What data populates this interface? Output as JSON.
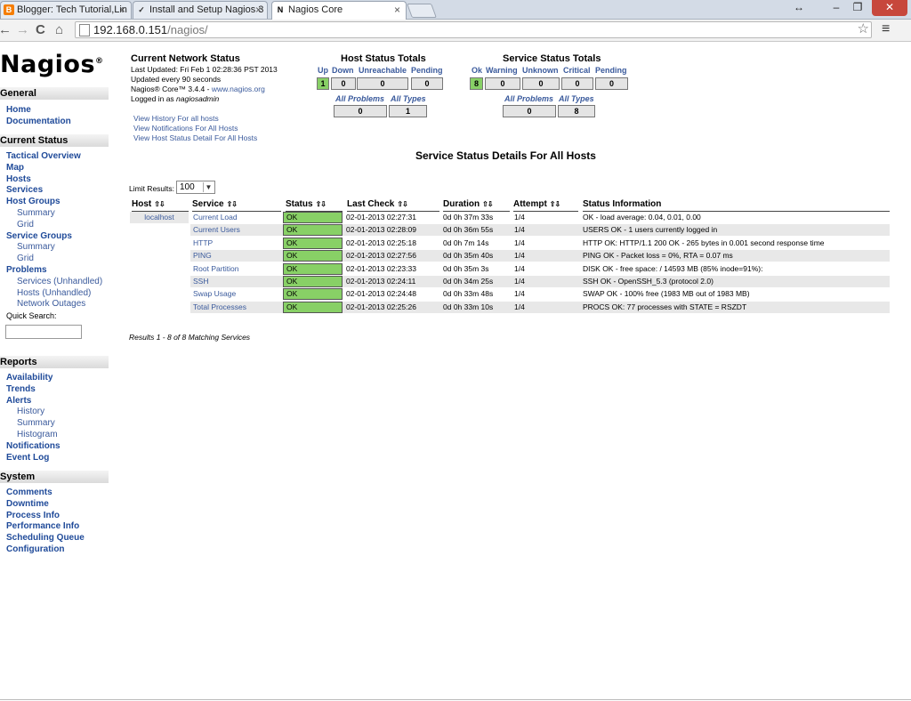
{
  "browser": {
    "tabs": [
      {
        "title": "Blogger: Tech Tutorial,Lin",
        "icon": "blogger-icon",
        "active": false
      },
      {
        "title": "Install and Setup Nagios 3",
        "icon": "checkmark-icon",
        "active": false
      },
      {
        "title": "Nagios Core",
        "icon": "nagios-n-icon",
        "active": true
      }
    ],
    "close_glyph": "×",
    "url_host": "192.168.0.151",
    "url_path": "/nagios/",
    "back": "←",
    "forward": "→",
    "reload": "C",
    "home": "⌂",
    "star": "☆",
    "menu": "≡",
    "win_resize": "↔",
    "win_min": "–",
    "win_max": "❐",
    "win_close": "✕"
  },
  "logo": {
    "text": "Nagios",
    "mark": "®"
  },
  "sidebar": {
    "sections": [
      {
        "title": "General",
        "items": [
          {
            "label": "Home",
            "sub": false
          },
          {
            "label": "Documentation",
            "sub": false
          }
        ]
      },
      {
        "title": "Current Status",
        "items": [
          {
            "label": "Tactical Overview",
            "sub": false
          },
          {
            "label": "Map",
            "sub": false
          },
          {
            "label": "Hosts",
            "sub": false
          },
          {
            "label": "Services",
            "sub": false
          },
          {
            "label": "Host Groups",
            "sub": false
          },
          {
            "label": "Summary",
            "sub": true
          },
          {
            "label": "Grid",
            "sub": true
          },
          {
            "label": "Service Groups",
            "sub": false
          },
          {
            "label": "Summary",
            "sub": true
          },
          {
            "label": "Grid",
            "sub": true
          },
          {
            "label": "Problems",
            "sub": false
          },
          {
            "label": "Services (Unhandled)",
            "sub": true
          },
          {
            "label": "Hosts (Unhandled)",
            "sub": true
          },
          {
            "label": "Network Outages",
            "sub": true
          }
        ]
      },
      {
        "title": "Reports",
        "items": [
          {
            "label": "Availability",
            "sub": false
          },
          {
            "label": "Trends",
            "sub": false
          },
          {
            "label": "Alerts",
            "sub": false
          },
          {
            "label": "History",
            "sub": true
          },
          {
            "label": "Summary",
            "sub": true
          },
          {
            "label": "Histogram",
            "sub": true
          },
          {
            "label": "Notifications",
            "sub": false
          },
          {
            "label": "Event Log",
            "sub": false
          }
        ]
      },
      {
        "title": "System",
        "items": [
          {
            "label": "Comments",
            "sub": false
          },
          {
            "label": "Downtime",
            "sub": false
          },
          {
            "label": "Process Info",
            "sub": false
          },
          {
            "label": "Performance Info",
            "sub": false
          },
          {
            "label": "Scheduling Queue",
            "sub": false
          },
          {
            "label": "Configuration",
            "sub": false
          }
        ]
      }
    ],
    "quick_search_label": "Quick Search:"
  },
  "network_status": {
    "title": "Current Network Status",
    "last_updated": "Last Updated: Fri Feb 1 02:28:36 PST 2013",
    "updated_every": "Updated every 90 seconds",
    "version_prefix": "Nagios® Core™ 3.4.4 - ",
    "version_link": "www.nagios.org",
    "logged_in_prefix": "Logged in as ",
    "logged_in_user": "nagiosadmin",
    "links": [
      "View History For all hosts",
      "View Notifications For All Hosts",
      "View Host Status Detail For All Hosts"
    ]
  },
  "host_totals": {
    "title": "Host Status Totals",
    "headers": [
      "Up",
      "Down",
      "Unreachable",
      "Pending"
    ],
    "values": [
      "1",
      "0",
      "0",
      "0"
    ],
    "sub_headers": [
      "All Problems",
      "All Types"
    ],
    "sub_values": [
      "0",
      "1"
    ]
  },
  "service_totals": {
    "title": "Service Status Totals",
    "headers": [
      "Ok",
      "Warning",
      "Unknown",
      "Critical",
      "Pending"
    ],
    "values": [
      "8",
      "0",
      "0",
      "0",
      "0"
    ],
    "sub_headers": [
      "All Problems",
      "All Types"
    ],
    "sub_values": [
      "0",
      "8"
    ]
  },
  "details": {
    "title": "Service Status Details For All Hosts",
    "limit_label": "Limit Results:",
    "limit_value": "100",
    "sort_glyph": "⇧⇩",
    "columns": [
      "Host",
      "Service",
      "Status",
      "Last Check",
      "Duration",
      "Attempt",
      "Status Information"
    ],
    "host": "localhost",
    "rows": [
      {
        "service": "Current Load",
        "status": "OK",
        "last_check": "02-01-2013 02:27:31",
        "duration": "0d 0h 37m 33s",
        "attempt": "1/4",
        "info": "OK - load average: 0.04, 0.01, 0.00"
      },
      {
        "service": "Current Users",
        "status": "OK",
        "last_check": "02-01-2013 02:28:09",
        "duration": "0d 0h 36m 55s",
        "attempt": "1/4",
        "info": "USERS OK - 1 users currently logged in"
      },
      {
        "service": "HTTP",
        "status": "OK",
        "last_check": "02-01-2013 02:25:18",
        "duration": "0d 0h 7m 14s",
        "attempt": "1/4",
        "info": "HTTP OK: HTTP/1.1 200 OK - 265 bytes in 0.001 second response time"
      },
      {
        "service": "PING",
        "status": "OK",
        "last_check": "02-01-2013 02:27:56",
        "duration": "0d 0h 35m 40s",
        "attempt": "1/4",
        "info": "PING OK - Packet loss = 0%, RTA = 0.07 ms"
      },
      {
        "service": "Root Partition",
        "status": "OK",
        "last_check": "02-01-2013 02:23:33",
        "duration": "0d 0h 35m 3s",
        "attempt": "1/4",
        "info": "DISK OK - free space: / 14593 MB (85% inode=91%):"
      },
      {
        "service": "SSH",
        "status": "OK",
        "last_check": "02-01-2013 02:24:11",
        "duration": "0d 0h 34m 25s",
        "attempt": "1/4",
        "info": "SSH OK - OpenSSH_5.3 (protocol 2.0)"
      },
      {
        "service": "Swap Usage",
        "status": "OK",
        "last_check": "02-01-2013 02:24:48",
        "duration": "0d 0h 33m 48s",
        "attempt": "1/4",
        "info": "SWAP OK - 100% free (1983 MB out of 1983 MB)"
      },
      {
        "service": "Total Processes",
        "status": "OK",
        "last_check": "02-01-2013 02:25:26",
        "duration": "0d 0h 33m 10s",
        "attempt": "1/4",
        "info": "PROCS OK: 77 processes with STATE = RSZDT"
      }
    ],
    "results_text": "Results 1 - 8 of 8 Matching Services"
  },
  "colors": {
    "ok_green": "#88d066",
    "link_blue": "#3a5a9c",
    "row_gray": "#e8e8e8"
  }
}
